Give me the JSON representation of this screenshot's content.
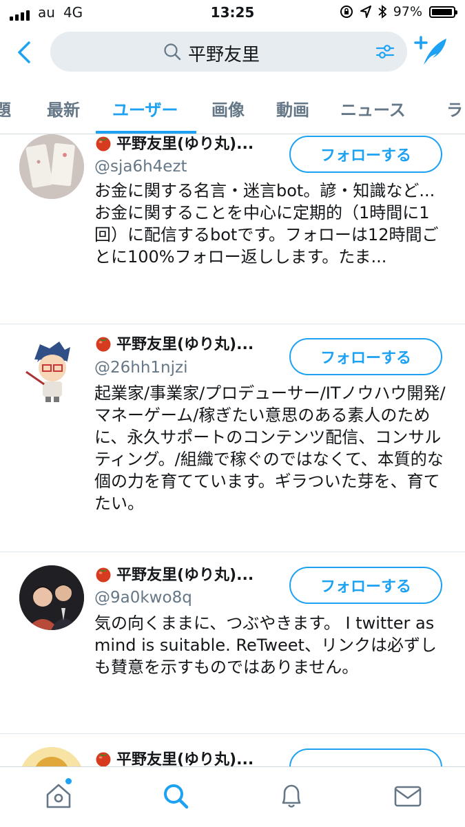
{
  "status_bar": {
    "carrier": "au",
    "network": "4G",
    "time": "13:25",
    "battery_percent": "97%",
    "battery_level": 0.97
  },
  "search": {
    "query": "平野友里"
  },
  "tabs": [
    {
      "label": "題",
      "active": false
    },
    {
      "label": "最新",
      "active": false
    },
    {
      "label": "ユーザー",
      "active": true
    },
    {
      "label": "画像",
      "active": false
    },
    {
      "label": "動画",
      "active": false
    },
    {
      "label": "ニュース",
      "active": false
    },
    {
      "label": "ラ",
      "active": false
    }
  ],
  "users": [
    {
      "name": "平野友里(ゆり丸)...",
      "handle": "@sja6h4ezt",
      "bio": "お金に関する名言・迷言bot。諺・知識など...お金に関することを中心に定期的（1時間に1回）に配信するbotです。フォローは12時間ごとに100%フォロー返しします。たま...",
      "follow_label": "フォローする"
    },
    {
      "name": "平野友里(ゆり丸)...",
      "handle": "@26hh1njzi",
      "bio": "起業家/事業家/プロデューサー/ITノウハウ開発/マネーゲーム/稼ぎたい意思のある素人のために、永久サポートのコンテンツ配信、コンサルティング。/組織で稼ぐのではなくて、本質的な個の力を育てています。ギラついた芽を、育てたい。",
      "follow_label": "フォローする"
    },
    {
      "name": "平野友里(ゆり丸)...",
      "handle": "@9a0kwo8q",
      "bio": "気の向くままに、つぶやきます。 I twitter as mind is suitable. ReTweet、リンクは必ずしも賛意を示すものではありません。",
      "follow_label": "フォローする"
    },
    {
      "name": "平野友里(ゆり丸)...",
      "handle": "",
      "bio": "",
      "follow_label": ""
    }
  ],
  "bottom_nav": {
    "items": [
      "home-icon",
      "search-icon",
      "bell-icon",
      "mail-icon"
    ],
    "active": "search-icon"
  },
  "colors": {
    "accent": "#1da1f2",
    "secondary_text": "#657786",
    "search_bg": "#e6ecf0"
  }
}
